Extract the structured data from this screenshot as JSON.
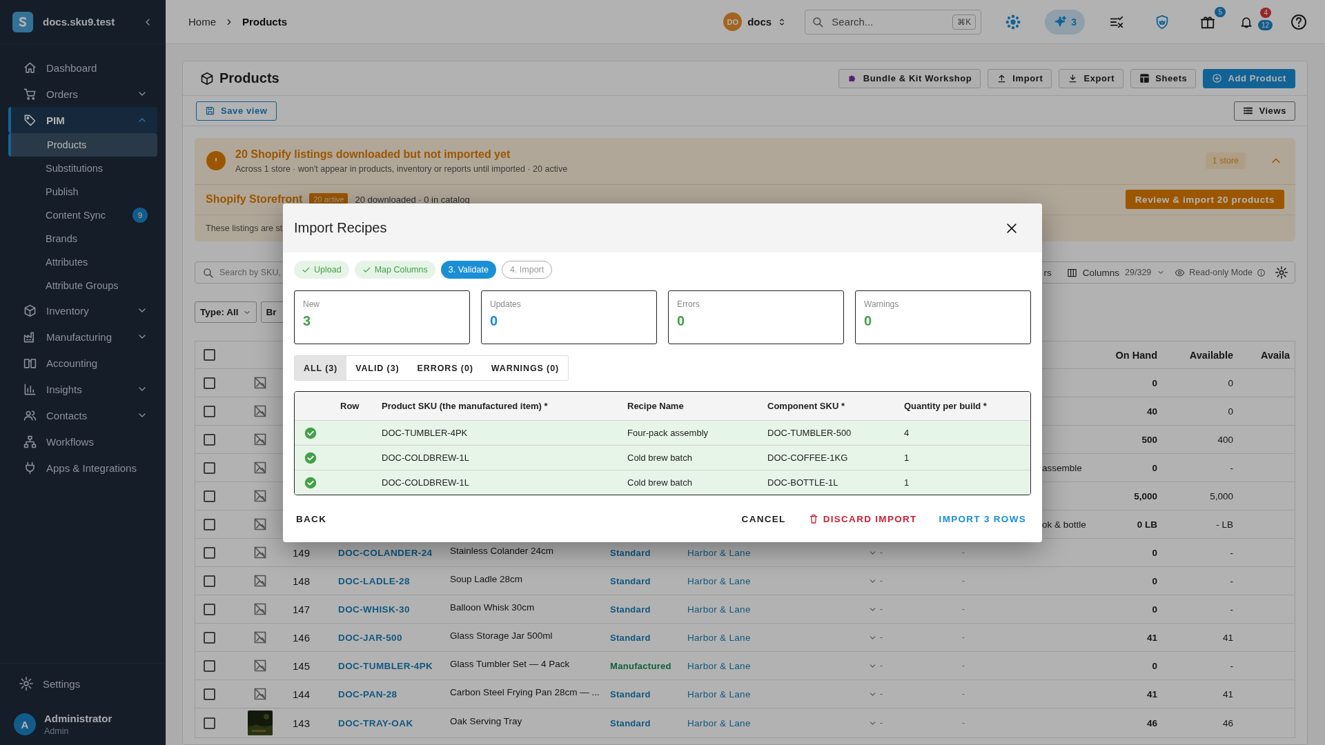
{
  "sidebar": {
    "brand": "docs.sku9.test",
    "items": [
      {
        "label": "Dashboard",
        "selected": false
      },
      {
        "label": "Orders",
        "selected": false,
        "expanded": false
      },
      {
        "label": "PIM",
        "selected": true,
        "expanded": true,
        "children": [
          {
            "label": "Products",
            "selected": true
          },
          {
            "label": "Substitutions",
            "selected": false
          },
          {
            "label": "Publish",
            "selected": false
          },
          {
            "label": "Content Sync",
            "selected": false,
            "badge": "9"
          },
          {
            "label": "Brands",
            "selected": false
          },
          {
            "label": "Attributes",
            "selected": false
          },
          {
            "label": "Attribute Groups",
            "selected": false
          }
        ]
      },
      {
        "label": "Inventory",
        "selected": false,
        "expanded": false
      },
      {
        "label": "Manufacturing",
        "selected": false,
        "expanded": false
      },
      {
        "label": "Accounting",
        "selected": false
      },
      {
        "label": "Insights",
        "selected": false,
        "expanded": false
      },
      {
        "label": "Contacts",
        "selected": false,
        "expanded": false
      },
      {
        "label": "Workflows",
        "selected": false
      },
      {
        "label": "Apps & Integrations",
        "selected": false
      }
    ],
    "settings": "Settings",
    "user": {
      "initial": "A",
      "name": "Administrator",
      "role": "Admin"
    }
  },
  "header": {
    "breadcrumbs": [
      "Home",
      "Products"
    ],
    "workspace": {
      "initials": "DO",
      "name": "docs"
    },
    "search": {
      "placeholder": "Search...",
      "shortcut": "⌘K"
    },
    "assistant_count": "3",
    "gift_badge": "5",
    "alerts_badge": "4",
    "notifications_badge": "12"
  },
  "page": {
    "title": "Products",
    "actions": [
      {
        "label": "Bundle & Kit Workshop",
        "kind": "default"
      },
      {
        "label": "Import",
        "kind": "default"
      },
      {
        "label": "Export",
        "kind": "default"
      },
      {
        "label": "Sheets",
        "kind": "default"
      },
      {
        "label": "Add Product",
        "kind": "primary"
      }
    ],
    "save_view": "Save view",
    "views": "Views",
    "alert": {
      "title": "20 Shopify listings downloaded but not imported yet",
      "subtitle": "Across 1 store · won't appear in products, inventory or reports until imported · 20 active",
      "store_count": "1 store",
      "expanded": true,
      "store": {
        "name": "Shopify Storefront",
        "tag": "20 active",
        "stats": "20 downloaded · 0 in catalog",
        "button": "Review & import 20 products"
      },
      "note": "These listings are st"
    },
    "toolbar": {
      "search_placeholder": "Search by SKU,",
      "cut_text": "rs",
      "columns_label": "Columns",
      "columns_count": "29/329",
      "mode": "Read-only Mode"
    },
    "filters": [
      "Type: All",
      "Br"
    ],
    "table": {
      "select_all_checked": false,
      "columns": [
        "On Hand",
        "Available",
        "Availa"
      ],
      "rows": [
        {
          "checked": false,
          "kind": "placeholder",
          "on_hand": "0",
          "available": "0"
        },
        {
          "checked": false,
          "kind": "placeholder",
          "on_hand": "40",
          "available": "0"
        },
        {
          "checked": false,
          "kind": "placeholder",
          "on_hand": "500",
          "available": "400"
        },
        {
          "checked": false,
          "kind": "placeholder",
          "note": "assemble",
          "on_hand": "0",
          "available": "-"
        },
        {
          "checked": false,
          "kind": "placeholder",
          "on_hand": "5,000",
          "available": "5,000"
        },
        {
          "checked": false,
          "kind": "placeholder",
          "note": "ok & bottle",
          "on_hand": "0 LB",
          "available": "- LB"
        },
        {
          "checked": false,
          "kind": "placeholder",
          "number": "149",
          "sku": "DOC-COLANDER-24",
          "name": "Stainless Colander 24cm",
          "type": "Standard",
          "manufactured": false,
          "brand": "Harbor & Lane",
          "column_8": "-",
          "column_9": "-",
          "on_hand": "0",
          "available": "-"
        },
        {
          "checked": false,
          "kind": "placeholder",
          "number": "148",
          "sku": "DOC-LADLE-28",
          "name": "Soup Ladle 28cm",
          "type": "Standard",
          "manufactured": false,
          "brand": "Harbor & Lane",
          "column_8": "-",
          "column_9": "-",
          "on_hand": "0",
          "available": "-"
        },
        {
          "checked": false,
          "kind": "placeholder",
          "number": "147",
          "sku": "DOC-WHISK-30",
          "name": "Balloon Whisk 30cm",
          "type": "Standard",
          "manufactured": false,
          "brand": "Harbor & Lane",
          "column_8": "-",
          "column_9": "-",
          "on_hand": "0",
          "available": "-"
        },
        {
          "checked": false,
          "kind": "placeholder",
          "number": "146",
          "sku": "DOC-JAR-500",
          "name": "Glass Storage Jar 500ml",
          "type": "Standard",
          "manufactured": false,
          "brand": "Harbor & Lane",
          "column_8": "-",
          "column_9": "-",
          "on_hand": "41",
          "available": "41"
        },
        {
          "checked": false,
          "kind": "placeholder",
          "number": "145",
          "sku": "DOC-TUMBLER-4PK",
          "name": "Glass Tumbler Set — 4 Pack",
          "type": "Manufactured",
          "manufactured": true,
          "brand": "Harbor & Lane",
          "column_8": "-",
          "column_9": "-",
          "on_hand": "0",
          "available": "-"
        },
        {
          "checked": false,
          "kind": "placeholder",
          "number": "144",
          "sku": "DOC-PAN-28",
          "name": "Carbon Steel Frying Pan 28cm — ...",
          "type": "Standard",
          "manufactured": false,
          "brand": "Harbor & Lane",
          "column_8": "-",
          "column_9": "-",
          "on_hand": "41",
          "available": "41"
        },
        {
          "checked": false,
          "kind": "picture",
          "number": "143",
          "sku": "DOC-TRAY-OAK",
          "name": "Oak Serving Tray",
          "type": "Standard",
          "manufactured": false,
          "brand": "Harbor & Lane",
          "column_8": "-",
          "column_9": "-",
          "on_hand": "46",
          "available": "46"
        }
      ]
    }
  },
  "modal": {
    "title": "Import Recipes",
    "steps": [
      {
        "label": "Upload",
        "kind": "done"
      },
      {
        "label": "Map Columns",
        "kind": "done"
      },
      {
        "label": "3. Validate",
        "kind": "current"
      },
      {
        "label": "4. Import",
        "kind": "pending"
      }
    ],
    "stats": [
      {
        "label": "New",
        "value": "3",
        "color": "#43a047"
      },
      {
        "label": "Updates",
        "value": "0",
        "color": "#1e88e5"
      },
      {
        "label": "Errors",
        "value": "0",
        "color": "#43a047"
      },
      {
        "label": "Warnings",
        "value": "0",
        "color": "#43a047"
      }
    ],
    "tabs": [
      {
        "label": "ALL (3)",
        "selected": true
      },
      {
        "label": "VALID (3)",
        "selected": false
      },
      {
        "label": "ERRORS (0)",
        "selected": false
      },
      {
        "label": "WARNINGS (0)",
        "selected": false
      }
    ],
    "columns": [
      "Row",
      "Product SKU (the manufactured item) *",
      "Recipe Name",
      "Component SKU *",
      "Quantity per build *"
    ],
    "rows": [
      {
        "kind": "valid",
        "cells": [
          "",
          "DOC-TUMBLER-4PK",
          "Four-pack assembly",
          "DOC-TUMBLER-500",
          "4"
        ]
      },
      {
        "kind": "valid",
        "cells": [
          "",
          "DOC-COLDBREW-1L",
          "Cold brew batch",
          "DOC-COFFEE-1KG",
          "1"
        ]
      },
      {
        "kind": "valid",
        "cells": [
          "",
          "DOC-COLDBREW-1L",
          "Cold brew batch",
          "DOC-BOTTLE-1L",
          "1"
        ]
      }
    ],
    "back": "BACK",
    "cancel": "CANCEL",
    "discard": "DISCARD IMPORT",
    "confirm": "IMPORT 3 ROWS"
  }
}
